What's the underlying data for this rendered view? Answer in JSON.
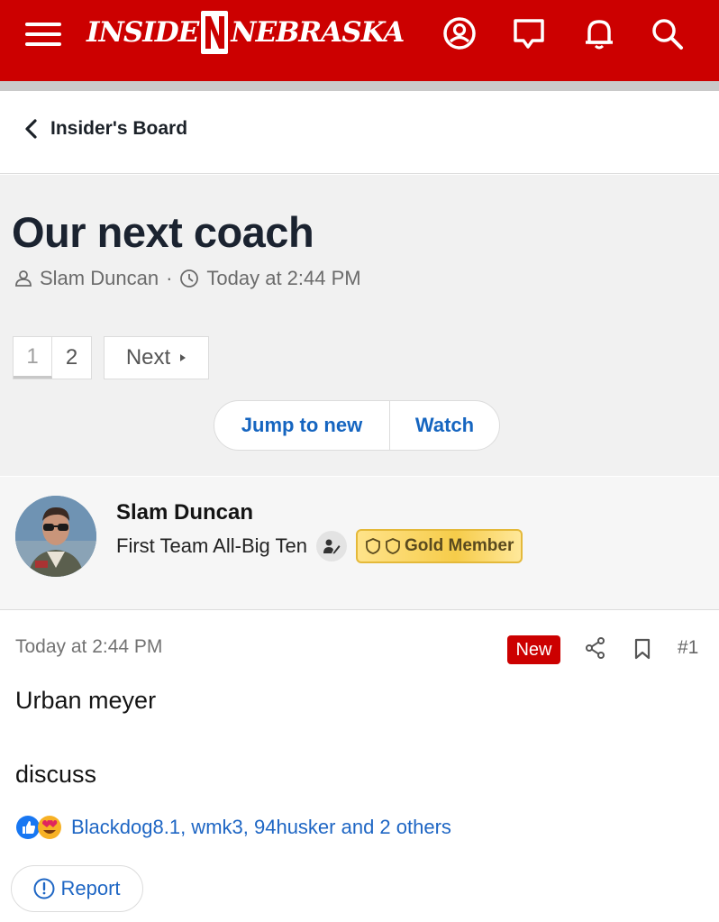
{
  "header": {
    "brand_left": "INSIDE",
    "brand_right": "NEBRASKA",
    "brand_color": "#cc0000"
  },
  "breadcrumb": {
    "label": "Insider's Board"
  },
  "thread": {
    "title": "Our next coach",
    "author": "Slam Duncan",
    "separator": "·",
    "date": "Today at 2:44 PM"
  },
  "pagination": {
    "pages": [
      "1",
      "2"
    ],
    "current": "1",
    "next_label": "Next"
  },
  "actions": {
    "jump_label": "Jump to new",
    "watch_label": "Watch"
  },
  "user": {
    "name": "Slam Duncan",
    "title": "First Team All-Big Ten",
    "badge_label": "Gold Member"
  },
  "post": {
    "date": "Today at 2:44 PM",
    "new_label": "New",
    "number": "#1",
    "lines": [
      "Urban meyer",
      "discuss"
    ],
    "reactions_text": "Blackdog8.1, wmk3, 94husker and 2 others",
    "report_label": "Report"
  },
  "icons": [
    "menu-icon",
    "account-icon",
    "chat-icon",
    "bell-icon",
    "search-icon",
    "chevron-left-icon",
    "user-icon",
    "clock-icon",
    "chevron-right-icon",
    "staff-icon",
    "shield-icon",
    "share-icon",
    "bookmark-icon",
    "like-icon",
    "love-icon",
    "alert-icon"
  ]
}
